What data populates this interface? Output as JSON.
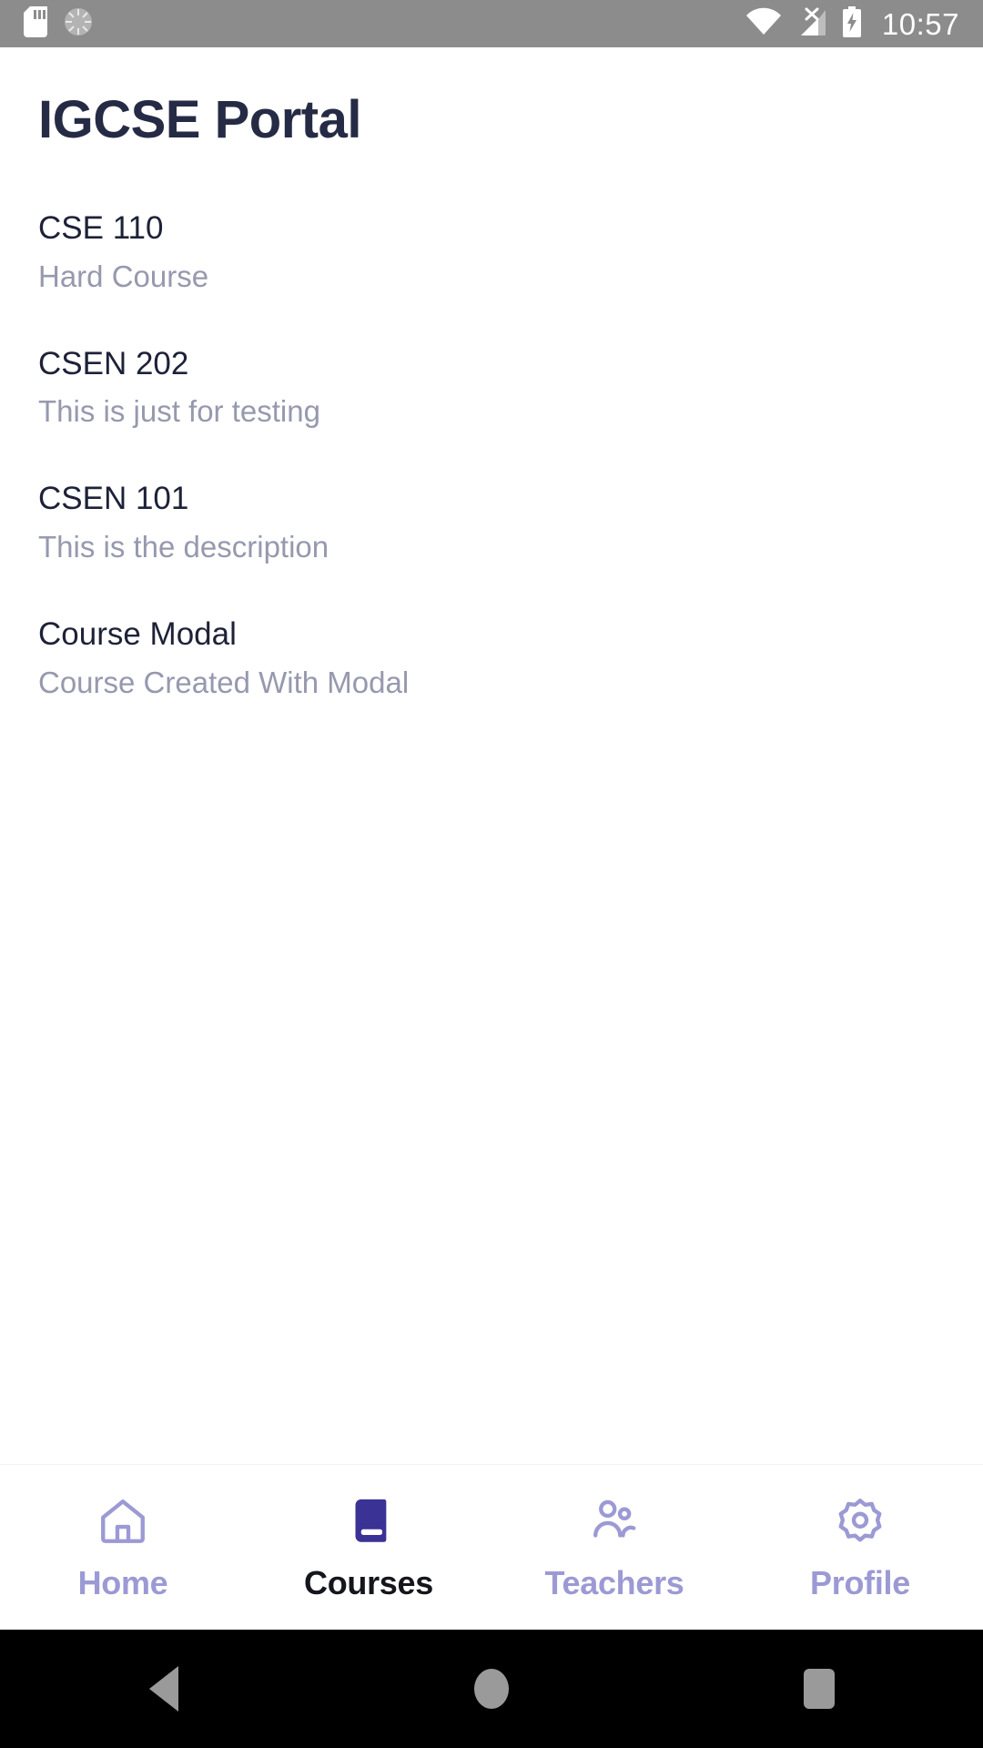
{
  "status_bar": {
    "time": "10:57",
    "icons_left": [
      "sd-card-icon",
      "sync-icon"
    ],
    "icons_right": [
      "wifi-icon",
      "cellular-no-sim-icon",
      "battery-charging-icon"
    ],
    "background_color": "#8c8c8c",
    "foreground_color": "#ffffff"
  },
  "header": {
    "title": "IGCSE Portal",
    "title_color": "#262b45"
  },
  "courses": [
    {
      "title": "CSE 110",
      "description": "Hard Course"
    },
    {
      "title": "CSEN 202",
      "description": "This is just for testing"
    },
    {
      "title": "CSEN 101",
      "description": "This is the description"
    },
    {
      "title": "Course Modal",
      "description": "Course Created With Modal"
    }
  ],
  "colors": {
    "course_title": "#1e2238",
    "course_description": "#9699ae",
    "tab_inactive": "#9c9ad4",
    "tab_active_label": "#15161d",
    "tab_active_icon": "#3b3295"
  },
  "tabs": [
    {
      "label": "Home",
      "icon": "home-icon",
      "active": false
    },
    {
      "label": "Courses",
      "icon": "book-icon",
      "active": true
    },
    {
      "label": "Teachers",
      "icon": "people-icon",
      "active": false
    },
    {
      "label": "Profile",
      "icon": "gear-icon",
      "active": false
    }
  ],
  "system_nav": {
    "buttons": [
      "back-button",
      "home-button",
      "recents-button"
    ]
  }
}
